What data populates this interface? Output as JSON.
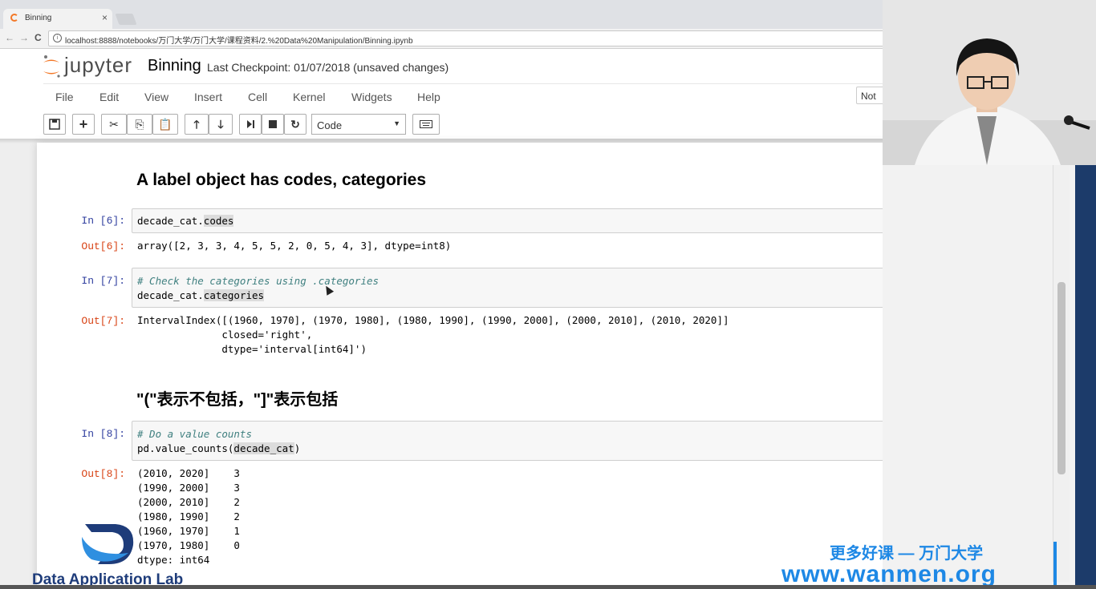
{
  "browser": {
    "tab_title": "Binning",
    "tab_close": "×",
    "url": "localhost:8888/notebooks/万门大学/万门大学/课程资料/2.%20Data%20Manipulation/Binning.ipynb",
    "nav_back": "←",
    "nav_forward": "→",
    "nav_reload": "C"
  },
  "jupyter": {
    "logo_text": "jupyter",
    "notebook_name": "Binning",
    "checkpoint": "Last Checkpoint: 01/07/2018 (unsaved changes)",
    "kernel_indicator": "Not Trusted",
    "menu": [
      "File",
      "Edit",
      "View",
      "Insert",
      "Cell",
      "Kernel",
      "Widgets",
      "Help"
    ],
    "cell_type": "Code"
  },
  "toolbar_icons": [
    "save-icon",
    "plus-icon",
    "cut-icon",
    "copy-icon",
    "paste-icon",
    "arrow-up-icon",
    "arrow-down-icon",
    "step-forward-icon",
    "stop-icon",
    "restart-icon",
    "chevron-down-icon",
    "keyboard-icon"
  ],
  "cells": {
    "md1": "A label object has codes, categories",
    "c6": {
      "in_prompt": "In  [6]:",
      "code_prefix": "decade_cat.",
      "code_attr": "codes",
      "out_prompt": "Out[6]:",
      "output": "array([2, 3, 3, 4, 5, 5, 2, 0, 5, 4, 3], dtype=int8)"
    },
    "c7": {
      "in_prompt": "In  [7]:",
      "comment": "# Check the categories using .categories",
      "code_prefix": "decade_cat.",
      "code_attr": "categories",
      "out_prompt": "Out[7]:",
      "output_lines": [
        "IntervalIndex([(1960, 1970], (1970, 1980], (1980, 1990], (1990, 2000], (2000, 2010], (2010, 2020]]",
        "              closed='right',",
        "              dtype='interval[int64]')"
      ]
    },
    "md2": "\"(\"表示不包括，\"]\"表示包括",
    "c8": {
      "in_prompt": "In  [8]:",
      "comment": "# Do a value counts",
      "code_prefix": "pd.value_counts(",
      "code_arg": "decade_cat",
      "code_suffix": ")",
      "out_prompt": "Out[8]:",
      "output_lines": [
        "(2010, 2020]    3",
        "(1990, 2000]    3",
        "(2000, 2010]    2",
        "(1980, 1990]    2",
        "(1960, 1970]    1",
        "(1970, 1980]    0",
        "dtype: int64"
      ]
    }
  },
  "watermarks": {
    "lab": "Data Application Lab",
    "promo": "更多好课 — 万门大学",
    "site": "www.wanmen.org"
  },
  "colors": {
    "in_prompt": "#303f9f",
    "out_prompt": "#d84315",
    "comment": "#408080",
    "watermark": "#1e88e5",
    "lab": "#1e3c7a"
  }
}
